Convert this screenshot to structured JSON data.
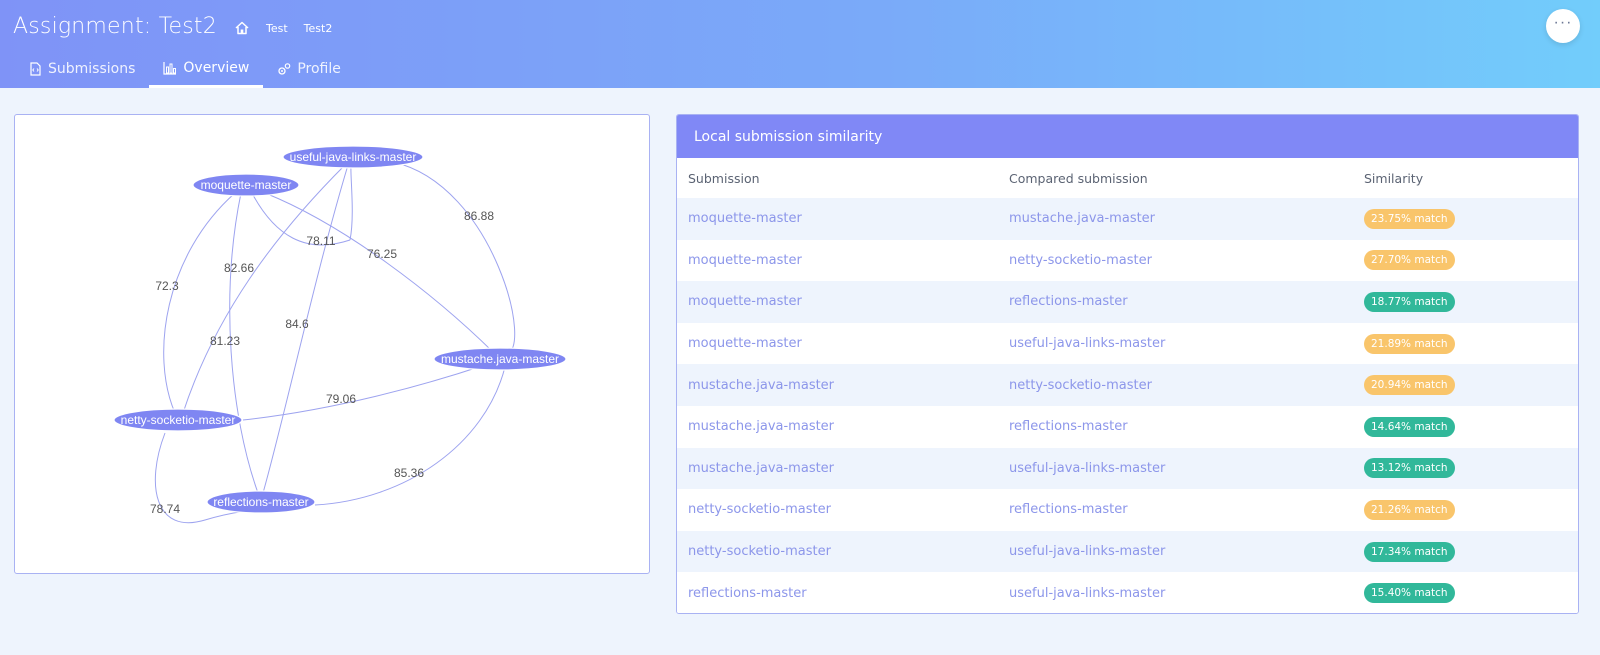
{
  "header": {
    "title": "Assignment: Test2",
    "breadcrumbs": [
      "Test",
      "Test2"
    ],
    "more_label": "···"
  },
  "tabs": [
    {
      "label": "Submissions",
      "icon": "file-code-icon",
      "active": false
    },
    {
      "label": "Overview",
      "icon": "bar-chart-icon",
      "active": true
    },
    {
      "label": "Profile",
      "icon": "gears-icon",
      "active": false
    }
  ],
  "graph": {
    "nodes": [
      {
        "id": "useful",
        "label": "useful-java-links-master"
      },
      {
        "id": "moquette",
        "label": "moquette-master"
      },
      {
        "id": "mustache",
        "label": "mustache.java-master"
      },
      {
        "id": "netty",
        "label": "netty-socketio-master"
      },
      {
        "id": "reflections",
        "label": "reflections-master"
      }
    ],
    "edges": [
      {
        "from": "useful",
        "to": "mustache",
        "weight": "86.88"
      },
      {
        "from": "moquette",
        "to": "useful",
        "weight": "78.11"
      },
      {
        "from": "moquette",
        "to": "mustache",
        "weight": "76.25"
      },
      {
        "from": "moquette",
        "to": "netty",
        "weight": "72.3"
      },
      {
        "from": "useful",
        "to": "netty",
        "weight": "82.66"
      },
      {
        "from": "useful",
        "to": "reflections",
        "weight": "84.6"
      },
      {
        "from": "moquette",
        "to": "reflections",
        "weight": "81.23"
      },
      {
        "from": "netty",
        "to": "mustache",
        "weight": "79.06"
      },
      {
        "from": "mustache",
        "to": "reflections",
        "weight": "85.36"
      },
      {
        "from": "netty",
        "to": "reflections",
        "weight": "78.74"
      }
    ]
  },
  "similarity": {
    "title": "Local submission similarity",
    "columns": [
      "Submission",
      "Compared submission",
      "Similarity"
    ],
    "rows": [
      {
        "a": "moquette-master",
        "b": "mustache.java-master",
        "sim": "23.75% match",
        "level": "warn"
      },
      {
        "a": "moquette-master",
        "b": "netty-socketio-master",
        "sim": "27.70% match",
        "level": "warn"
      },
      {
        "a": "moquette-master",
        "b": "reflections-master",
        "sim": "18.77% match",
        "level": "ok"
      },
      {
        "a": "moquette-master",
        "b": "useful-java-links-master",
        "sim": "21.89% match",
        "level": "warn"
      },
      {
        "a": "mustache.java-master",
        "b": "netty-socketio-master",
        "sim": "20.94% match",
        "level": "warn"
      },
      {
        "a": "mustache.java-master",
        "b": "reflections-master",
        "sim": "14.64% match",
        "level": "ok"
      },
      {
        "a": "mustache.java-master",
        "b": "useful-java-links-master",
        "sim": "13.12% match",
        "level": "ok"
      },
      {
        "a": "netty-socketio-master",
        "b": "reflections-master",
        "sim": "21.26% match",
        "level": "warn"
      },
      {
        "a": "netty-socketio-master",
        "b": "useful-java-links-master",
        "sim": "17.34% match",
        "level": "ok"
      },
      {
        "a": "reflections-master",
        "b": "useful-java-links-master",
        "sim": "15.40% match",
        "level": "ok"
      }
    ]
  },
  "colors": {
    "accent": "#8088f6",
    "node": "#7f86f2",
    "edge": "#9da3ef",
    "link": "#8c96ea",
    "badge_warn": "#f9c56b",
    "badge_ok": "#31b89a"
  }
}
